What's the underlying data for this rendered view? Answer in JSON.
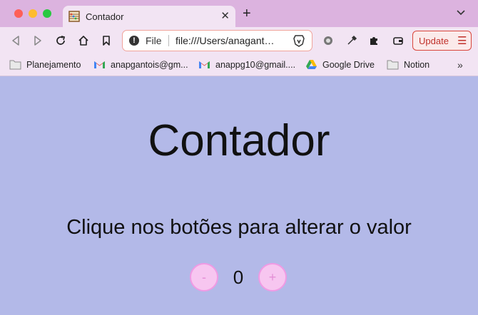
{
  "browser": {
    "tab": {
      "title": "Contador"
    },
    "address_bar": {
      "scheme_label": "File",
      "url": "file:///Users/anagantois/"
    },
    "update_button": {
      "label": "Update"
    },
    "bookmarks": [
      {
        "label": "Planejamento",
        "icon": "folder-icon"
      },
      {
        "label": "anapgantois@gm...",
        "icon": "gmail-icon"
      },
      {
        "label": "anappg10@gmail....",
        "icon": "gmail-icon"
      },
      {
        "label": "Google Drive",
        "icon": "google-drive-icon"
      },
      {
        "label": "Notion",
        "icon": "folder-icon"
      }
    ],
    "colors": {
      "accent": "#d9463b",
      "tab_strip": "#dcb3df",
      "toolbar": "#f2e4f3"
    }
  },
  "page": {
    "title": "Contador",
    "subtitle": "Clique nos botões para alterar o valor",
    "counter": {
      "decrement_label": "-",
      "value": "0",
      "increment_label": "+"
    },
    "colors": {
      "background": "#b3b9e8",
      "button_fill": "#f7c6f0",
      "button_border": "#f09ae4"
    }
  }
}
